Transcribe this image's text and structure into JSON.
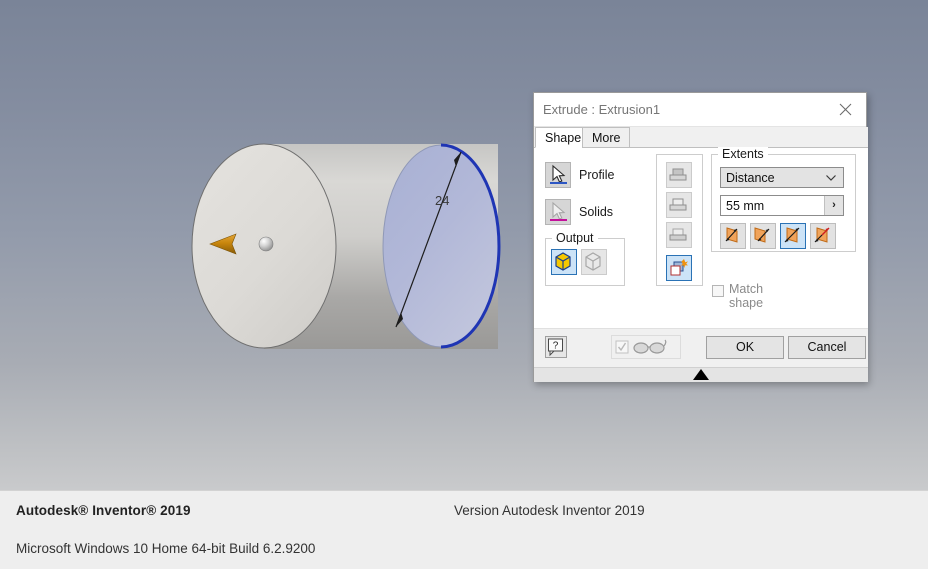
{
  "dialog": {
    "title": "Extrude : Extrusion1",
    "close_icon": "close-icon",
    "tabs": [
      {
        "label": "Shape",
        "active": true
      },
      {
        "label": "More",
        "active": false
      }
    ],
    "selectors": [
      {
        "label": "Profile",
        "icon": "cursor-arrow-icon",
        "bar_color": "#2d57c4",
        "active": true
      },
      {
        "label": "Solids",
        "icon": "cursor-arrow-icon",
        "bar_color": "#c3119b",
        "active": false
      }
    ],
    "output": {
      "legend": "Output",
      "buttons": [
        {
          "name": "solid-output-button",
          "icon": "solid-cube-icon",
          "selected": true
        },
        {
          "name": "surface-output-button",
          "icon": "surface-cube-icon",
          "selected": false
        }
      ]
    },
    "boolean_ops": [
      {
        "name": "join-button",
        "icon": "join-icon",
        "selected": false,
        "enabled": false
      },
      {
        "name": "cut-button",
        "icon": "cut-icon",
        "selected": false,
        "enabled": false
      },
      {
        "name": "intersect-button",
        "icon": "intersect-icon",
        "selected": false,
        "enabled": false
      },
      {
        "name": "new-solid-button",
        "icon": "new-solid-icon",
        "selected": true,
        "enabled": true
      }
    ],
    "extents": {
      "legend": "Extents",
      "type_value": "Distance",
      "chevron_icon": "chevron-down-icon",
      "distance_value": "55 mm",
      "distance_more_icon": "chevron-right-icon",
      "directions": [
        {
          "name": "direction-1-button",
          "icon": "direction-1-icon",
          "selected": false
        },
        {
          "name": "direction-2-button",
          "icon": "direction-2-icon",
          "selected": false
        },
        {
          "name": "direction-symmetric-button",
          "icon": "direction-symmetric-icon",
          "selected": true
        },
        {
          "name": "direction-asymmetric-button",
          "icon": "direction-asymmetric-icon",
          "selected": false
        }
      ]
    },
    "match_shape": {
      "label": "Match shape",
      "checked": false,
      "enabled": false
    },
    "footer_controls": {
      "help_label": "?",
      "preview_icon": "glasses-icon",
      "preview_checked": true,
      "preview_enabled": false,
      "ok_label": "OK",
      "cancel_label": "Cancel",
      "resize_icon": "triangle-up-icon"
    }
  },
  "viewport": {
    "dimension_label": "24",
    "arrow_icon": "direction-arrow-icon",
    "handle_icon": "sphere-handle-icon",
    "colors": {
      "background_top": "#7a8498",
      "background_bottom": "#c9cacc",
      "profile_highlight": "#1f35b4",
      "arrow": "#c8860d",
      "cylinder_face": "#dedcd8"
    }
  },
  "footer": {
    "product": "Autodesk® Inventor® 2019",
    "version": "Version Autodesk Inventor 2019",
    "os": "Microsoft Windows 10 Home 64-bit Build 6.2.9200"
  }
}
